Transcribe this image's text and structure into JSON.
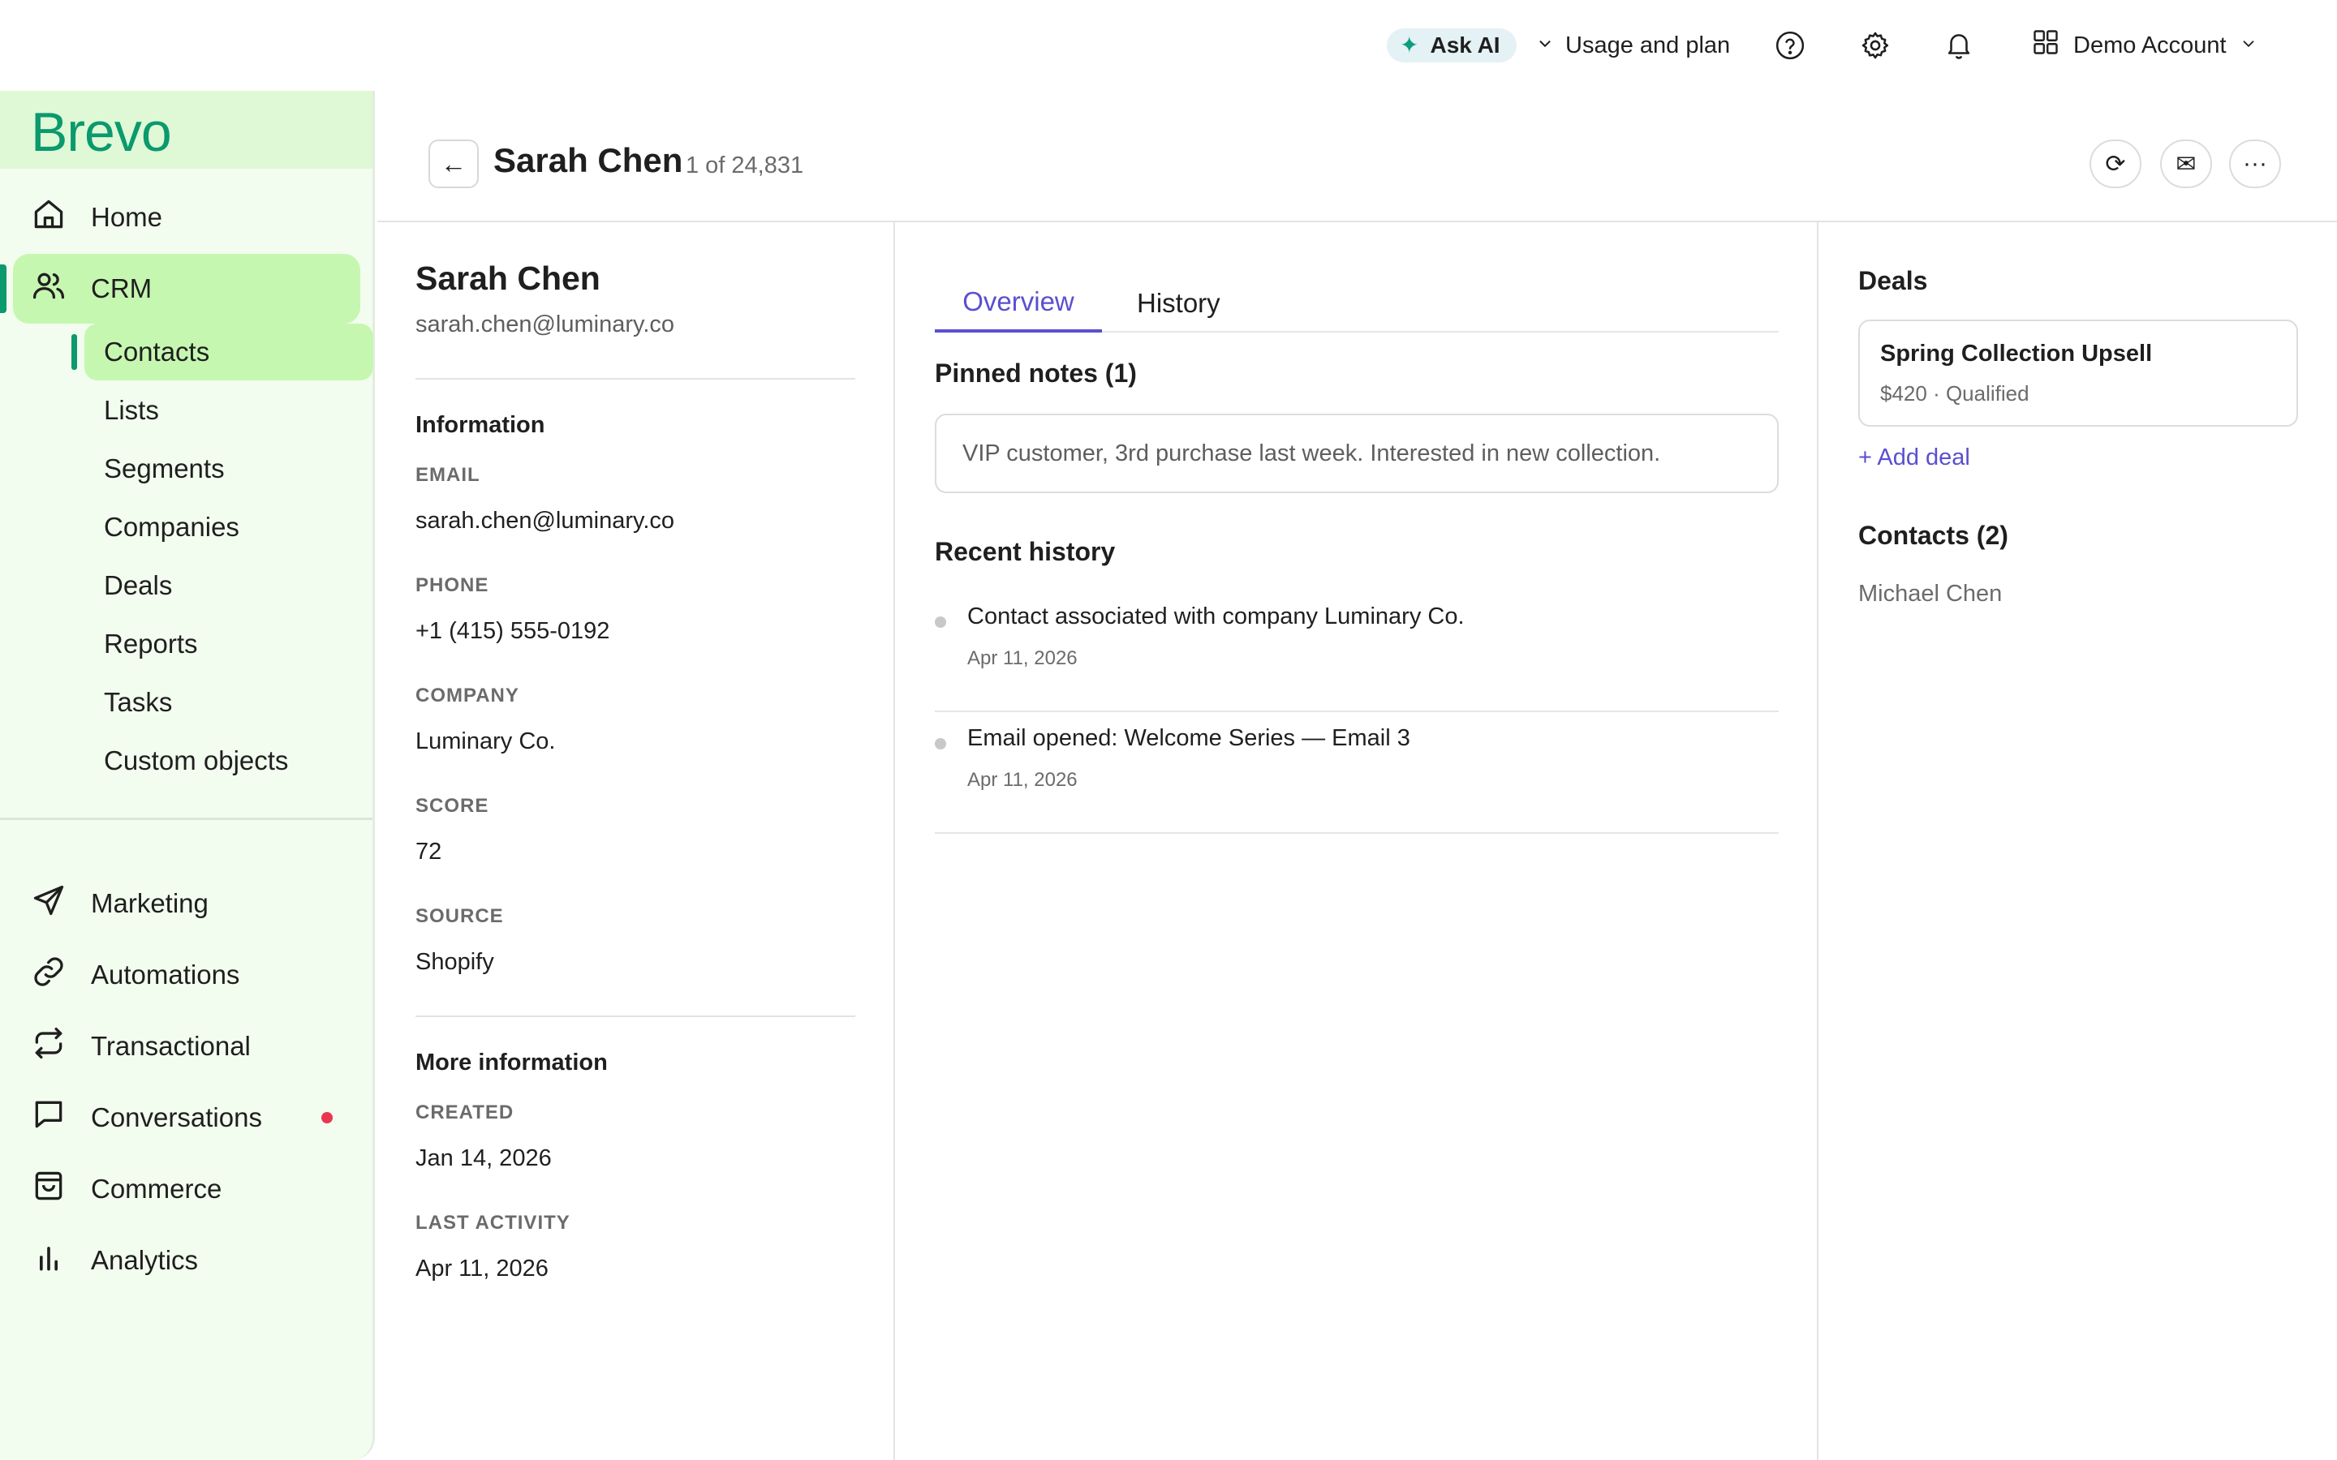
{
  "topbar": {
    "ask_ai_label": "Ask AI",
    "usage_label": "Usage and plan",
    "account_label": "Demo Account"
  },
  "sidebar": {
    "logo": "Brevo",
    "nav_primary": [
      {
        "label": "Home",
        "icon": "home-icon"
      },
      {
        "label": "CRM",
        "icon": "users-icon",
        "active": true
      }
    ],
    "crm_subitems": [
      "Contacts",
      "Lists",
      "Segments",
      "Companies",
      "Deals",
      "Reports",
      "Tasks",
      "Custom objects"
    ],
    "active_subitem": "Contacts",
    "nav_secondary": [
      {
        "label": "Marketing",
        "icon": "send-icon"
      },
      {
        "label": "Automations",
        "icon": "link-icon"
      },
      {
        "label": "Transactional",
        "icon": "repeat-icon"
      },
      {
        "label": "Conversations",
        "icon": "chat-icon",
        "has_notification": true
      },
      {
        "label": "Commerce",
        "icon": "shopping-bag-icon"
      },
      {
        "label": "Analytics",
        "icon": "bar-chart-icon"
      }
    ]
  },
  "header": {
    "contact_name": "Sarah Chen",
    "position": "1 of 24,831"
  },
  "contact": {
    "name": "Sarah Chen",
    "email": "sarah.chen@luminary.co",
    "information_title": "Information",
    "fields": [
      {
        "label": "EMAIL",
        "value": "sarah.chen@luminary.co"
      },
      {
        "label": "PHONE",
        "value": "+1 (415) 555-0192"
      },
      {
        "label": "COMPANY",
        "value": "Luminary Co."
      },
      {
        "label": "SCORE",
        "value": "72"
      },
      {
        "label": "SOURCE",
        "value": "Shopify"
      }
    ],
    "more_info_title": "More information",
    "more_fields": [
      {
        "label": "CREATED",
        "value": "Jan 14, 2026"
      },
      {
        "label": "LAST ACTIVITY",
        "value": "Apr 11, 2026"
      }
    ]
  },
  "main": {
    "tabs": [
      {
        "label": "Overview",
        "active": true
      },
      {
        "label": "History",
        "active": false
      }
    ],
    "pinned_title": "Pinned notes (1)",
    "pinned_note": "VIP customer, 3rd purchase last week. Interested in new collection.",
    "recent_title": "Recent history",
    "history": [
      {
        "text": "Contact associated with company Luminary Co.",
        "date": "Apr 11, 2026"
      },
      {
        "text": "Email opened: Welcome Series — Email 3",
        "date": "Apr 11, 2026"
      }
    ]
  },
  "right": {
    "deals_title": "Deals",
    "deal": {
      "name": "Spring Collection Upsell",
      "meta": "$420 · Qualified"
    },
    "add_deal_label": "+ Add deal",
    "contacts_title": "Contacts (2)",
    "related_contact": "Michael Chen"
  },
  "colors": {
    "brand_green": "#0b996e",
    "active_bg": "#c6f7b1",
    "sidebar_bg": "#f3fdef",
    "accent_purple": "#5a4fd0",
    "notification_red": "#e8364f"
  }
}
